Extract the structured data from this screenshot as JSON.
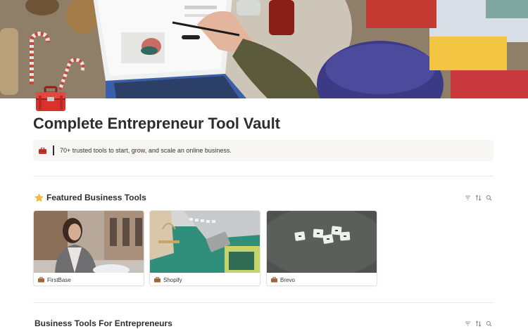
{
  "page": {
    "title": "Complete Entrepreneur Tool Vault",
    "icon": "toolbox-icon",
    "cover": "workspace-photo"
  },
  "callout": {
    "icon": "briefcase-icon",
    "text": "70+ trusted tools to start, grow, and scale an online business."
  },
  "featured": {
    "title": "Featured Business Tools",
    "icon": "star-icon",
    "toolbar": [
      "filter-icon",
      "sort-icon",
      "search-icon"
    ],
    "cards": [
      {
        "label": "FirstBase",
        "icon": "briefcase-icon",
        "image": "woman-in-blazer-photo"
      },
      {
        "label": "Shopify",
        "icon": "briefcase-icon",
        "image": "shopping-bag-desk-photo"
      },
      {
        "label": "Brevo",
        "icon": "briefcase-icon",
        "image": "letter-tiles-photo"
      }
    ]
  },
  "tools": {
    "title": "Business Tools For Entrepreneurs",
    "toolbar": [
      "filter-icon",
      "sort-icon",
      "search-icon"
    ]
  },
  "colors": {
    "text": "#37352f",
    "callout_bg": "#f7f6f3",
    "divider": "#e9e9e7",
    "toolbox_red": "#d8312e"
  }
}
